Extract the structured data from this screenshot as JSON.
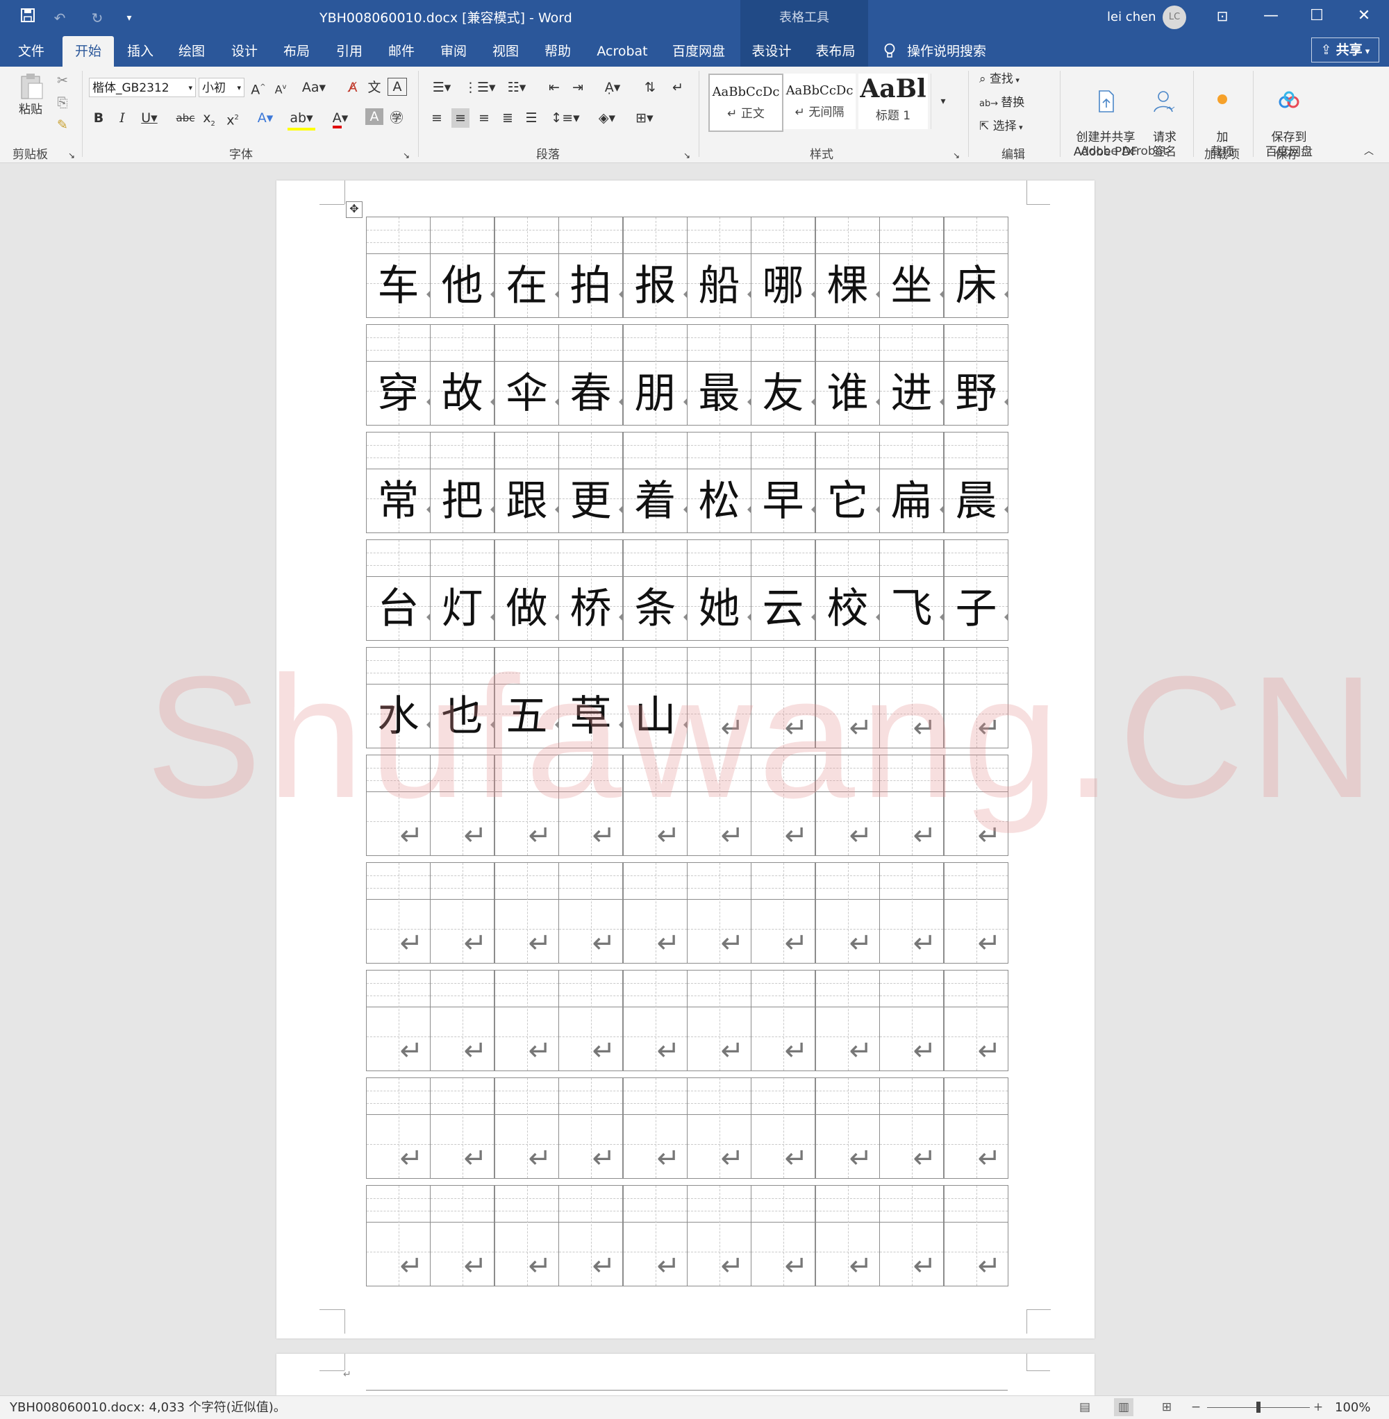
{
  "window": {
    "title": "YBH008060010.docx [兼容模式]  -  Word",
    "contextual": "表格工具",
    "user": "lei chen",
    "avatar": "LC"
  },
  "quick_access": [
    "save-icon",
    "undo-icon",
    "redo-icon",
    "customize-icon"
  ],
  "tabs": [
    "文件",
    "开始",
    "插入",
    "绘图",
    "设计",
    "布局",
    "引用",
    "邮件",
    "审阅",
    "视图",
    "帮助",
    "Acrobat",
    "百度网盘",
    "表设计",
    "表布局"
  ],
  "active_tab": "开始",
  "tell_me": "操作说明搜索",
  "share": "共享",
  "ribbon": {
    "clipboard": {
      "label": "剪贴板",
      "paste": "粘贴"
    },
    "font": {
      "label": "字体",
      "family": "楷体_GB2312",
      "size": "小初"
    },
    "paragraph": {
      "label": "段落"
    },
    "styles": {
      "label": "样式",
      "items": [
        {
          "preview": "AaBbCcDc",
          "name": "↵ 正文"
        },
        {
          "preview": "AaBbCcDc",
          "name": "↵ 无间隔"
        },
        {
          "preview": "AaBl",
          "name": "标题 1"
        }
      ]
    },
    "editing": {
      "label": "编辑",
      "find": "查找",
      "replace": "替换",
      "select": "选择"
    },
    "acrobat": {
      "label": "Adobe Acrobat",
      "create": "创建并共享\nAdobe PDF",
      "sign": "请求\n签名"
    },
    "addins": {
      "label": "加载项",
      "button": "加\n载项"
    },
    "save": {
      "label": "保存",
      "button": "保存到\n百度网盘"
    }
  },
  "grid_rows": [
    [
      "车",
      "他",
      "在",
      "拍",
      "报",
      "船",
      "哪",
      "棵",
      "坐",
      "床"
    ],
    [
      "穿",
      "故",
      "伞",
      "春",
      "朋",
      "最",
      "友",
      "谁",
      "进",
      "野"
    ],
    [
      "常",
      "把",
      "跟",
      "更",
      "着",
      "松",
      "早",
      "它",
      "扁",
      "晨"
    ],
    [
      "台",
      "灯",
      "做",
      "桥",
      "条",
      "她",
      "云",
      "校",
      "飞",
      "子"
    ],
    [
      "水",
      "也",
      "五",
      "草",
      "山",
      "",
      "",
      "",
      "",
      ""
    ],
    [
      "",
      "",
      "",
      "",
      "",
      "",
      "",
      "",
      "",
      ""
    ],
    [
      "",
      "",
      "",
      "",
      "",
      "",
      "",
      "",
      "",
      ""
    ],
    [
      "",
      "",
      "",
      "",
      "",
      "",
      "",
      "",
      "",
      ""
    ],
    [
      "",
      "",
      "",
      "",
      "",
      "",
      "",
      "",
      "",
      ""
    ],
    [
      "",
      "",
      "",
      "",
      "",
      "",
      "",
      "",
      "",
      ""
    ]
  ],
  "watermark": "Shufawang.CN",
  "status": {
    "text": "YBH008060010.docx: 4,033 个字符(近似值)。",
    "zoom": "100%",
    "zoom_fraction": 0.5
  },
  "colors": {
    "accent": "#2b579a",
    "ribbon_bg": "#f3f3f3",
    "page_bg": "#e6e6e6",
    "watermark": "#e58e8e"
  }
}
